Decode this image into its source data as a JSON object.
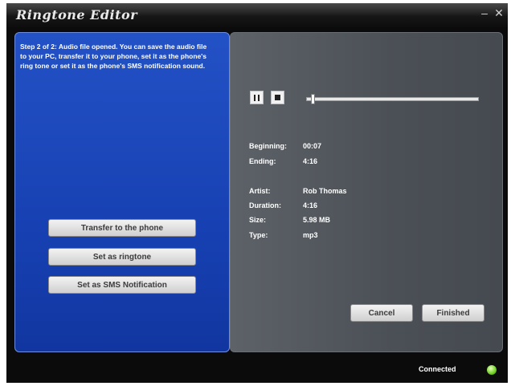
{
  "window": {
    "title": "Ringtone Editor",
    "minimize_glyph": "–",
    "close_glyph": "✕"
  },
  "left_panel": {
    "step_message": "Step 2 of 2: Audio file opened. You can save the audio file to your PC, transfer it to your phone, set it as the phone's ring tone or set it as the phone's SMS notification sound.",
    "buttons": {
      "transfer": "Transfer to the phone",
      "ringtone": "Set as ringtone",
      "sms": "Set as SMS Notification"
    }
  },
  "player": {
    "pause_icon": "pause-icon",
    "stop_icon": "stop-icon",
    "position": 0.02
  },
  "info": {
    "beginning_label": "Beginning:",
    "beginning_value": "00:07",
    "ending_label": "Ending:",
    "ending_value": "4:16",
    "artist_label": "Artist:",
    "artist_value": "Rob Thomas",
    "duration_label": "Duration:",
    "duration_value": "4:16",
    "size_label": "Size:",
    "size_value": "5.98 MB",
    "type_label": "Type:",
    "type_value": "mp3"
  },
  "actions": {
    "cancel": "Cancel",
    "finished": "Finished"
  },
  "status": {
    "text": "Connected",
    "led_color": "#79d42a"
  }
}
